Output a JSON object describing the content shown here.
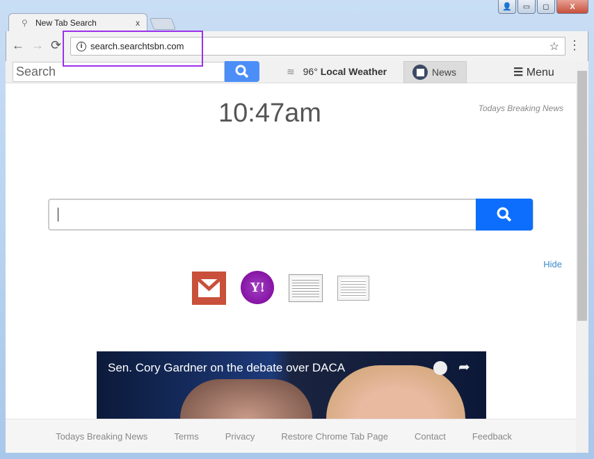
{
  "window": {
    "user_icon": "user-icon",
    "minimize": "minimize-icon",
    "maximize": "maximize-icon",
    "close": "X"
  },
  "tab": {
    "title": "New Tab Search",
    "close": "x"
  },
  "toolbar": {
    "back": "←",
    "forward": "→",
    "reload": "⟳",
    "url": "search.searchtsbn.com",
    "star": "☆",
    "kebab": "⋮"
  },
  "page_toolbar": {
    "search_placeholder": "Search",
    "weather_temp": "96°",
    "weather_label": "Local Weather",
    "news_label": "News",
    "menu_label": "Menu"
  },
  "main": {
    "time": "10:47am",
    "breaking_news": "Todays Breaking News",
    "hide": "Hide",
    "search_value": ""
  },
  "shortcuts": [
    {
      "name": "Gmail",
      "color": "#c9503a"
    },
    {
      "name": "Yahoo",
      "color": "#7b0099"
    },
    {
      "name": "Wall Street Journal"
    },
    {
      "name": "Daily News"
    }
  ],
  "video": {
    "title": "Sen. Cory Gardner on the debate over DACA"
  },
  "footer": {
    "links": [
      "Todays Breaking News",
      "Terms",
      "Privacy",
      "Restore Chrome Tab Page",
      "Contact",
      "Feedback"
    ]
  },
  "colors": {
    "highlight": "#9b30ea",
    "search_button": "#0d6efd",
    "link": "#3a8ac9"
  }
}
